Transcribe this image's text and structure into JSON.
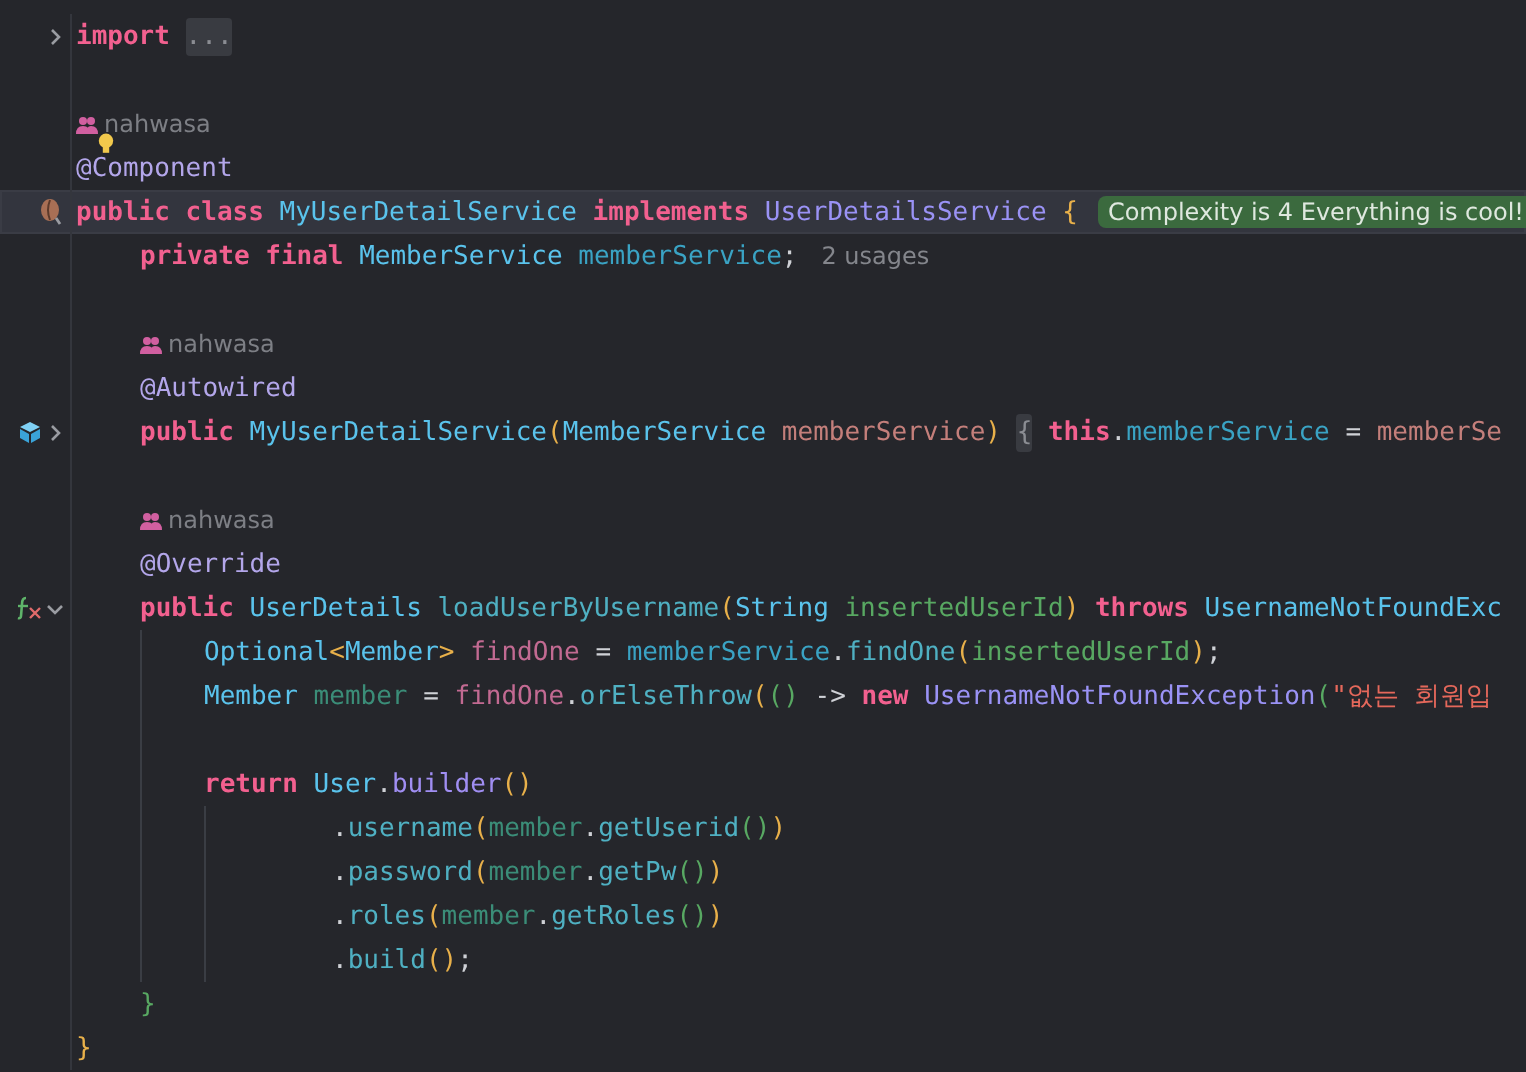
{
  "editor": {
    "lines": [
      {
        "kind": "code",
        "gutter": {
          "kind": "fold"
        },
        "current": false,
        "tokens": [
          {
            "text": "import ",
            "kind": "keyword"
          },
          {
            "text": "...",
            "kind": "fold"
          }
        ]
      },
      {
        "kind": "blank",
        "current": false
      },
      {
        "kind": "author",
        "current": false,
        "text": "nahwasa"
      },
      {
        "kind": "code",
        "overlay": {
          "kind": "bulb"
        },
        "current": false,
        "tokens": [
          {
            "text": "@Component",
            "kind": "annotation"
          }
        ]
      },
      {
        "kind": "code",
        "gutter": {
          "kind": "bean"
        },
        "current": true,
        "hint": {
          "kind": "complexity",
          "text": "Complexity is 4 Everything is cool!"
        },
        "tokens": [
          {
            "text": "public class ",
            "kind": "keyword"
          },
          {
            "text": "MyUserDetailService ",
            "kind": "class"
          },
          {
            "text": "implements ",
            "kind": "keyword"
          },
          {
            "text": "UserDetailsService ",
            "kind": "interface"
          },
          {
            "text": "{",
            "kind": "paren"
          }
        ],
        "children": [
          {
            "kind": "code",
            "current": false,
            "hint": {
              "kind": "usages",
              "text": "2 usages"
            },
            "tokens": [
              {
                "text": "private final ",
                "kind": "keyword"
              },
              {
                "text": "MemberService ",
                "kind": "class"
              },
              {
                "text": "memberService",
                "kind": "field"
              },
              {
                "text": ";",
                "kind": "plain"
              }
            ]
          },
          {
            "kind": "blank",
            "current": false
          },
          {
            "kind": "author",
            "current": false,
            "text": "nahwasa"
          },
          {
            "kind": "code",
            "current": false,
            "tokens": [
              {
                "text": "@Autowired",
                "kind": "annotation"
              }
            ]
          },
          {
            "kind": "code",
            "gutter": {
              "kind": "bean-fold"
            },
            "current": false,
            "tokens": [
              {
                "text": "public ",
                "kind": "keyword"
              },
              {
                "text": "MyUserDetailService",
                "kind": "class"
              },
              {
                "text": "(",
                "kind": "paren"
              },
              {
                "text": "MemberService ",
                "kind": "class"
              },
              {
                "text": "memberService",
                "kind": "param"
              },
              {
                "text": ") ",
                "kind": "paren"
              },
              {
                "text": "{",
                "kind": "fold"
              },
              {
                "text": " this",
                "kind": "keyword"
              },
              {
                "text": ".",
                "kind": "plain"
              },
              {
                "text": "memberService",
                "kind": "field"
              },
              {
                "text": " = ",
                "kind": "plain"
              },
              {
                "text": "memberSe",
                "kind": "param"
              }
            ]
          },
          {
            "kind": "blank",
            "current": false
          },
          {
            "kind": "author",
            "current": false,
            "text": "nahwasa"
          },
          {
            "kind": "code",
            "current": false,
            "tokens": [
              {
                "text": "@Override",
                "kind": "annotation"
              }
            ]
          },
          {
            "kind": "code",
            "gutter": {
              "kind": "fx-fold"
            },
            "current": false,
            "tokens": [
              {
                "text": "public ",
                "kind": "keyword"
              },
              {
                "text": "UserDetails ",
                "kind": "class"
              },
              {
                "text": "loadUserByUsername",
                "kind": "method"
              },
              {
                "text": "(",
                "kind": "paren"
              },
              {
                "text": "String ",
                "kind": "class"
              },
              {
                "text": "insertedUserId",
                "kind": "param-alt"
              },
              {
                "text": ")",
                "kind": "paren"
              },
              {
                "text": " throws ",
                "kind": "keyword"
              },
              {
                "text": "UsernameNotFoundExc",
                "kind": "class"
              }
            ],
            "children": [
              {
                "kind": "code",
                "current": false,
                "tokens": [
                  {
                    "text": "Optional",
                    "kind": "class"
                  },
                  {
                    "text": "<",
                    "kind": "paren"
                  },
                  {
                    "text": "Member",
                    "kind": "class"
                  },
                  {
                    "text": "> ",
                    "kind": "paren"
                  },
                  {
                    "text": "findOne",
                    "kind": "local"
                  },
                  {
                    "text": " = ",
                    "kind": "plain"
                  },
                  {
                    "text": "memberService",
                    "kind": "field"
                  },
                  {
                    "text": ".",
                    "kind": "plain"
                  },
                  {
                    "text": "findOne",
                    "kind": "method"
                  },
                  {
                    "text": "(",
                    "kind": "paren"
                  },
                  {
                    "text": "insertedUserId",
                    "kind": "param-alt"
                  },
                  {
                    "text": ")",
                    "kind": "paren"
                  },
                  {
                    "text": ";",
                    "kind": "plain"
                  }
                ]
              },
              {
                "kind": "code",
                "current": false,
                "tokens": [
                  {
                    "text": "Member ",
                    "kind": "class"
                  },
                  {
                    "text": "member",
                    "kind": "local-alt"
                  },
                  {
                    "text": " = ",
                    "kind": "plain"
                  },
                  {
                    "text": "findOne",
                    "kind": "local"
                  },
                  {
                    "text": ".",
                    "kind": "plain"
                  },
                  {
                    "text": "orElseThrow",
                    "kind": "method"
                  },
                  {
                    "text": "(",
                    "kind": "paren"
                  },
                  {
                    "text": "()",
                    "kind": "paren-alt"
                  },
                  {
                    "text": " -> ",
                    "kind": "plain"
                  },
                  {
                    "text": "new ",
                    "kind": "keyword"
                  },
                  {
                    "text": "UsernameNotFoundException",
                    "kind": "interface"
                  },
                  {
                    "text": "(",
                    "kind": "paren-alt"
                  },
                  {
                    "text": "\"없는 회원입",
                    "kind": "string"
                  }
                ]
              },
              {
                "kind": "blank",
                "current": false
              },
              {
                "kind": "code",
                "current": false,
                "tokens": [
                  {
                    "text": "return ",
                    "kind": "keyword"
                  },
                  {
                    "text": "User",
                    "kind": "class"
                  },
                  {
                    "text": ".",
                    "kind": "plain"
                  },
                  {
                    "text": "builder",
                    "kind": "static"
                  },
                  {
                    "text": "()",
                    "kind": "paren"
                  }
                ],
                "continuation": [
                  {
                    "kind": "code",
                    "current": false,
                    "tokens": [
                      {
                        "text": ".",
                        "kind": "plain"
                      },
                      {
                        "text": "username",
                        "kind": "method"
                      },
                      {
                        "text": "(",
                        "kind": "paren"
                      },
                      {
                        "text": "member",
                        "kind": "local-alt"
                      },
                      {
                        "text": ".",
                        "kind": "plain"
                      },
                      {
                        "text": "getUserid",
                        "kind": "method"
                      },
                      {
                        "text": "()",
                        "kind": "paren-alt"
                      },
                      {
                        "text": ")",
                        "kind": "paren"
                      }
                    ]
                  },
                  {
                    "kind": "code",
                    "current": false,
                    "tokens": [
                      {
                        "text": ".",
                        "kind": "plain"
                      },
                      {
                        "text": "password",
                        "kind": "method"
                      },
                      {
                        "text": "(",
                        "kind": "paren"
                      },
                      {
                        "text": "member",
                        "kind": "local-alt"
                      },
                      {
                        "text": ".",
                        "kind": "plain"
                      },
                      {
                        "text": "getPw",
                        "kind": "method"
                      },
                      {
                        "text": "()",
                        "kind": "paren-alt"
                      },
                      {
                        "text": ")",
                        "kind": "paren"
                      }
                    ]
                  },
                  {
                    "kind": "code",
                    "current": false,
                    "tokens": [
                      {
                        "text": ".",
                        "kind": "plain"
                      },
                      {
                        "text": "roles",
                        "kind": "method"
                      },
                      {
                        "text": "(",
                        "kind": "paren"
                      },
                      {
                        "text": "member",
                        "kind": "local-alt"
                      },
                      {
                        "text": ".",
                        "kind": "plain"
                      },
                      {
                        "text": "getRoles",
                        "kind": "method"
                      },
                      {
                        "text": "()",
                        "kind": "paren-alt"
                      },
                      {
                        "text": ")",
                        "kind": "paren"
                      }
                    ]
                  },
                  {
                    "kind": "code",
                    "current": false,
                    "tokens": [
                      {
                        "text": ".",
                        "kind": "plain"
                      },
                      {
                        "text": "build",
                        "kind": "method"
                      },
                      {
                        "text": "()",
                        "kind": "paren"
                      },
                      {
                        "text": ";",
                        "kind": "plain"
                      }
                    ]
                  }
                ]
              }
            ]
          },
          {
            "kind": "code",
            "current": false,
            "tokens": [
              {
                "text": "}",
                "kind": "paren-alt"
              }
            ]
          }
        ]
      },
      {
        "kind": "code",
        "current": false,
        "tokens": [
          {
            "text": "}",
            "kind": "paren"
          }
        ]
      }
    ]
  }
}
